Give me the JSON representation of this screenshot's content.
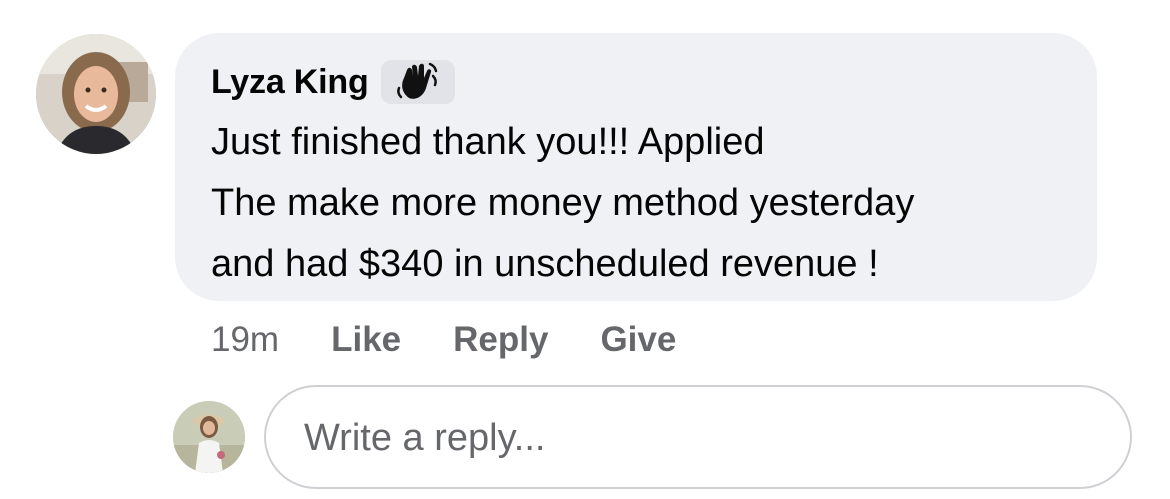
{
  "comment": {
    "author": "Lyza King",
    "badge_icon": "waving-hand-icon",
    "text_lines": [
      "Just finished thank you!!! Applied",
      "The make more money method yesterday",
      "and had $340 in unscheduled revenue !"
    ],
    "timestamp": "19m",
    "actions": {
      "like": "Like",
      "reply": "Reply",
      "give": "Give"
    }
  },
  "reply": {
    "placeholder": "Write a reply..."
  },
  "colors": {
    "bubble_bg": "#f0f1f4",
    "secondary_text": "#65676b",
    "primary_text": "#050505"
  }
}
